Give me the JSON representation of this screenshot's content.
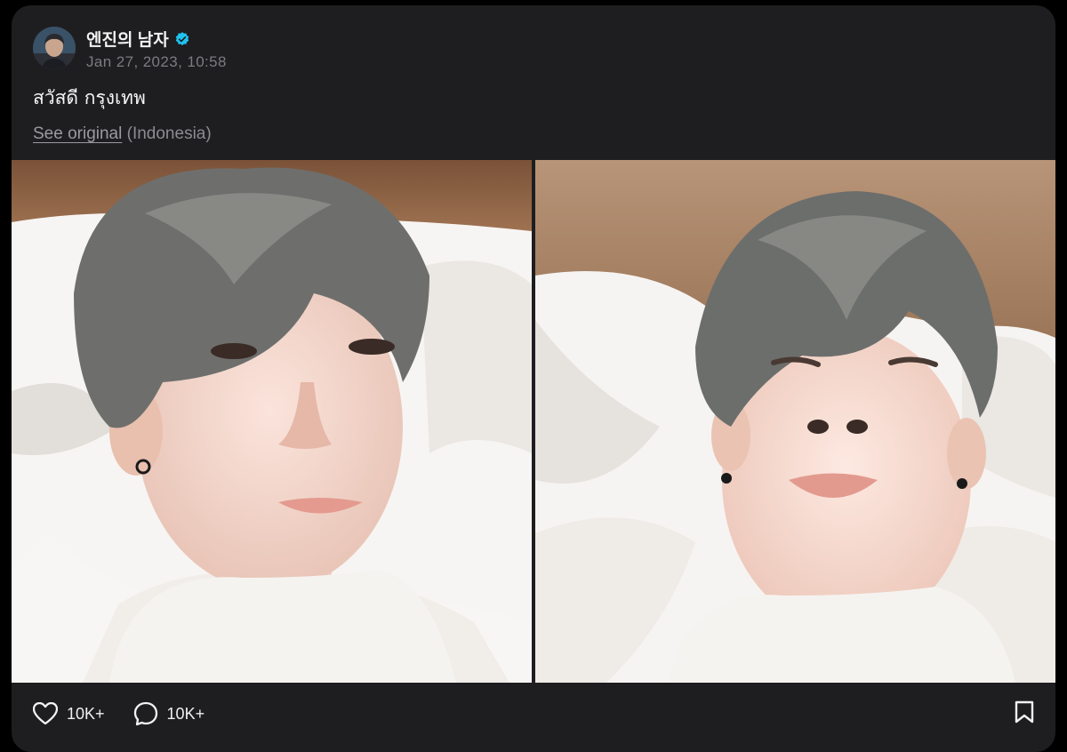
{
  "post": {
    "author": "엔진의 남자",
    "verified": true,
    "timestamp": "Jan 27, 2023, 10:58",
    "text": "สวัสดี กรุงเทพ",
    "see_original": "See original",
    "language": "(Indonesia)",
    "photos": [
      {
        "icon": "selfie-photo-1"
      },
      {
        "icon": "selfie-photo-2"
      }
    ],
    "likes": "10K+",
    "comments": "10K+"
  },
  "colors": {
    "card_bg": "#1e1e20",
    "verified": "#1fc3f0",
    "muted": "#7b7b80"
  }
}
